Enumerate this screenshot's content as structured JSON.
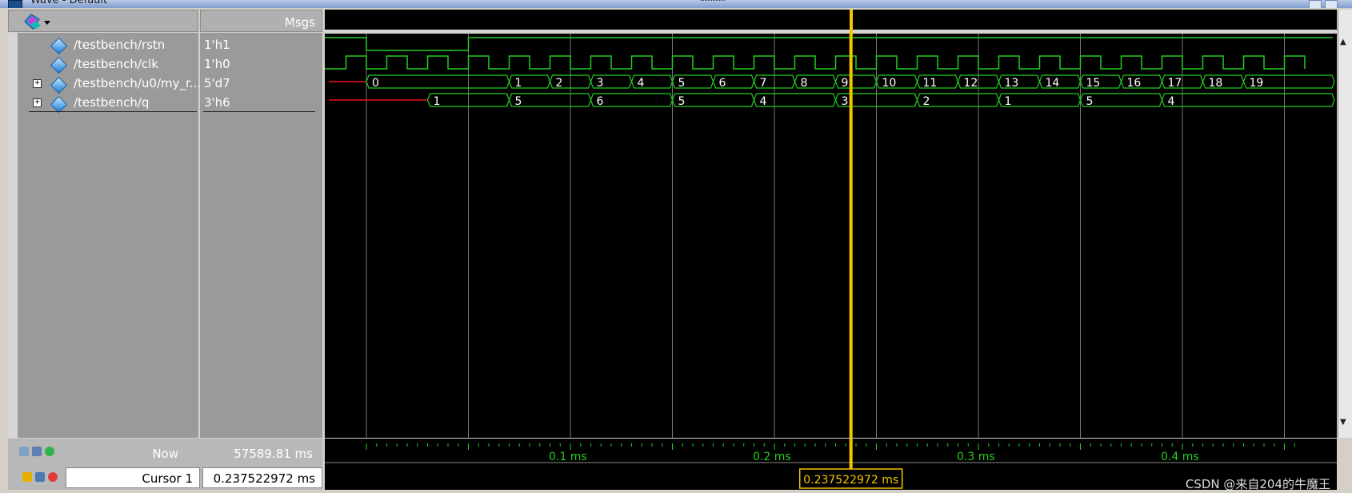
{
  "window": {
    "title": "Wave - Default"
  },
  "header": {
    "msgs_label": "Msgs"
  },
  "signals": [
    {
      "name": "/testbench/rstn",
      "value": "1'h1",
      "expandable": false
    },
    {
      "name": "/testbench/clk",
      "value": "1'h0",
      "expandable": false
    },
    {
      "name": "/testbench/u0/my_r...",
      "value": "5'd7",
      "expandable": true
    },
    {
      "name": "/testbench/q",
      "value": "3'h6",
      "expandable": true
    }
  ],
  "bus_values": {
    "count": [
      "0",
      "1",
      "2",
      "3",
      "4",
      "5",
      "6",
      "7",
      "8",
      "9",
      "10",
      "11",
      "12",
      "13",
      "14",
      "15",
      "16",
      "17",
      "18",
      "19"
    ],
    "q": [
      "1",
      "5",
      "6",
      "5",
      "4",
      "3",
      "2",
      "1",
      "5",
      "4"
    ]
  },
  "status": {
    "now_label": "Now",
    "now_value": "57589.81 ms",
    "cursor_label": "Cursor 1",
    "cursor_value": "0.237522972 ms",
    "cursor_readout": "0.237522972 ms"
  },
  "timeline": {
    "ticks": [
      "0.1 ms",
      "0.2 ms",
      "0.3 ms",
      "0.4 ms"
    ],
    "cursor_time_ms": 0.237522972
  },
  "watermark": "CSDN @来自204的牛魔王",
  "colors": {
    "wave": "#22cc22",
    "undefined": "#ee1111",
    "cursor": "#f5c400",
    "background": "#000000",
    "panel": "#9a9a9a",
    "grid": "#777777"
  },
  "icons": [
    "diamond-signal-icon",
    "expand-plus-icon",
    "wave-toolbar-icon",
    "lock-icon",
    "wrench-icon",
    "remove-cursor-icon",
    "add-cursor-icon"
  ]
}
